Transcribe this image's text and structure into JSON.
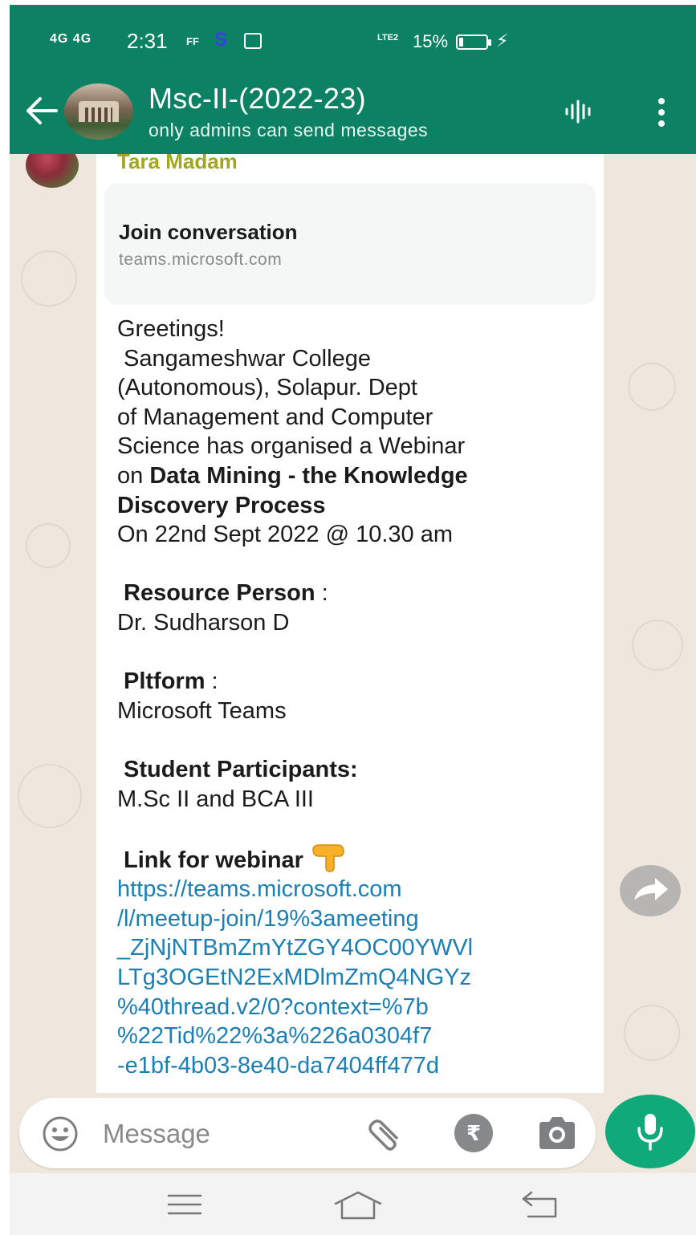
{
  "status_bar": {
    "signal": "4G 4G",
    "time": "2:31",
    "ff": "FF",
    "s_app": "S",
    "volte": "LTE2",
    "battery_text": "15%",
    "battery_level": 0.15
  },
  "header": {
    "title": "Msc-II-(2022-23)",
    "subtitle": "only admins can send messages"
  },
  "message": {
    "sender": "Tara Madam",
    "link_preview": {
      "title": "Join conversation",
      "domain": "teams.microsoft.com"
    },
    "greeting": "Greetings!",
    "line1": " Sangameshwar College",
    "line2": "(Autonomous), Solapur. Dept",
    "line3": "of Management and Computer",
    "line4": "Science has organised a Webinar",
    "line5_prefix": "on ",
    "topic1": "Data Mining - the Knowledge",
    "topic2": "Discovery Process",
    "date_line": "On 22nd Sept 2022 @ 10.30 am",
    "resource_label": "Resource Person",
    "resource_sep": " :",
    "resource_value": "Dr. Sudharson D",
    "platform_label": "Pltform",
    "platform_sep": " :",
    "platform_value": "Microsoft Teams",
    "participants_label": "Student Participants:",
    "participants_value": "M.Sc II and BCA III",
    "link_label": "Link for webinar",
    "url_lines": [
      "https://teams.microsoft.com",
      "/l/meetup-join/19%3ameeting",
      "_ZjNjNTBmZmYtZGY4OC00YWVl",
      "LTg3OGEtN2ExMDlmZmQ4NGYz",
      "%40thread.v2/0?context=%7b",
      "%22Tid%22%3a%226a0304f7",
      "-e1bf-4b03-8e40-da7404ff477d"
    ]
  },
  "input": {
    "placeholder": "Message"
  },
  "icons": {
    "back": "arrow-left-icon",
    "voice": "voice-wave-icon",
    "menu": "more-vert-icon",
    "emoji": "emoji-icon",
    "attach": "paperclip-icon",
    "payment": "rupee-icon",
    "camera": "camera-icon",
    "mic": "mic-icon",
    "share": "forward-icon",
    "scroll": "double-chevron-down-icon"
  },
  "colors": {
    "header_green": "#0c8163",
    "mic_green": "#0fa97a",
    "link_blue": "#1a7fb4",
    "sender_name": "#a4a61f",
    "chat_bg": "#efe7dd"
  }
}
